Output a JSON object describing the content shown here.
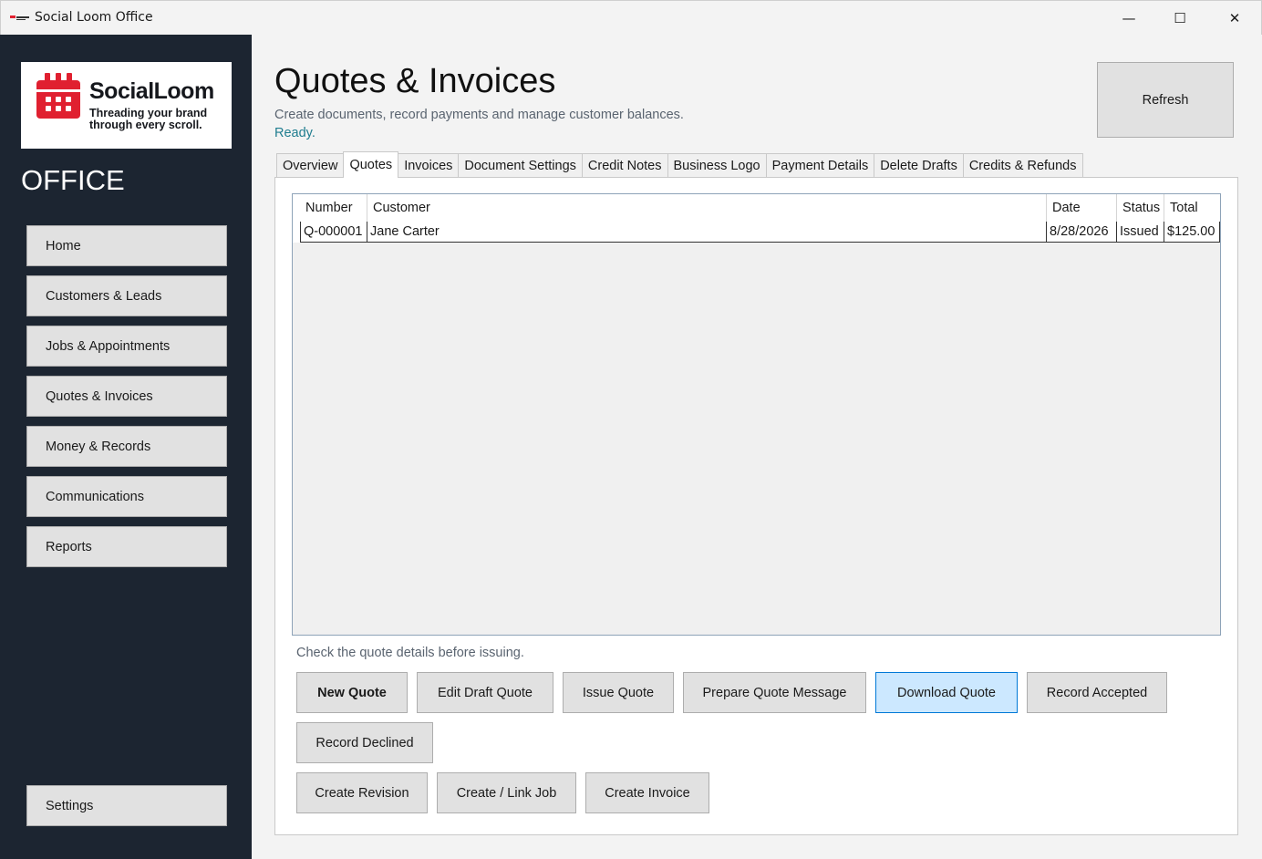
{
  "window": {
    "title": "Social Loom Office",
    "minimize_glyph": "—",
    "maximize_glyph": "☐",
    "close_glyph": "✕"
  },
  "sidebar": {
    "logo": {
      "name": "SocialLoom",
      "tagline": "Threading your brand through every scroll.",
      "icon": "calendar-loom-icon",
      "color": "#e02030"
    },
    "section_label": "OFFICE",
    "items": [
      {
        "label": "Home"
      },
      {
        "label": "Customers & Leads"
      },
      {
        "label": "Jobs & Appointments"
      },
      {
        "label": "Quotes & Invoices"
      },
      {
        "label": "Money & Records"
      },
      {
        "label": "Communications"
      },
      {
        "label": "Reports"
      }
    ],
    "settings_label": "Settings"
  },
  "header": {
    "title": "Quotes & Invoices",
    "subtitle": "Create documents, record payments and manage customer balances.",
    "status": "Ready.",
    "refresh_label": "Refresh"
  },
  "tabs": [
    {
      "label": "Overview",
      "active": false
    },
    {
      "label": "Quotes",
      "active": true
    },
    {
      "label": "Invoices",
      "active": false
    },
    {
      "label": "Document Settings",
      "active": false
    },
    {
      "label": "Credit Notes",
      "active": false
    },
    {
      "label": "Business Logo",
      "active": false
    },
    {
      "label": "Payment Details",
      "active": false
    },
    {
      "label": "Delete Drafts",
      "active": false
    },
    {
      "label": "Credits & Refunds",
      "active": false
    }
  ],
  "quotes_table": {
    "columns": [
      "Number",
      "Customer",
      "Date",
      "Status",
      "Total"
    ],
    "rows": [
      [
        "Q-000001",
        "Jane Carter",
        "8/28/2026",
        "Issued",
        "$125.00"
      ]
    ]
  },
  "hint": "Check the quote details before issuing.",
  "actions": {
    "new_quote": "New Quote",
    "edit_draft": "Edit Draft Quote",
    "issue": "Issue Quote",
    "prepare_message": "Prepare Quote Message",
    "download": "Download Quote",
    "record_accepted": "Record Accepted",
    "record_declined": "Record Declined",
    "create_revision": "Create Revision",
    "create_link_job": "Create / Link Job",
    "create_invoice": "Create Invoice"
  },
  "colors": {
    "sidebar_bg": "#1c2531",
    "status_text": "#1f7d8f",
    "hover_button": "#cce8ff"
  }
}
